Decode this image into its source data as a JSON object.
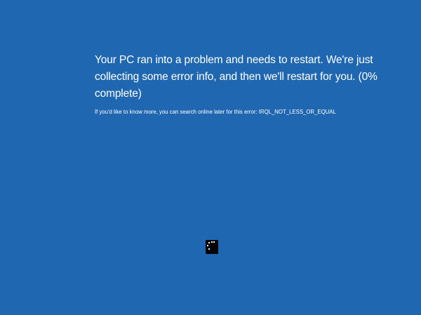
{
  "screen": {
    "background_color": "#2067b2",
    "message": "Your PC ran into a problem and needs to restart. We're just collecting some error info, and then we'll restart for you. (0% complete)",
    "progress_percent": 0,
    "info_text": "If you'd like to know more, you can search online later for this error: IRQL_NOT_LESS_OR_EQUAL",
    "spinner_icon": "loading-dots-icon"
  }
}
